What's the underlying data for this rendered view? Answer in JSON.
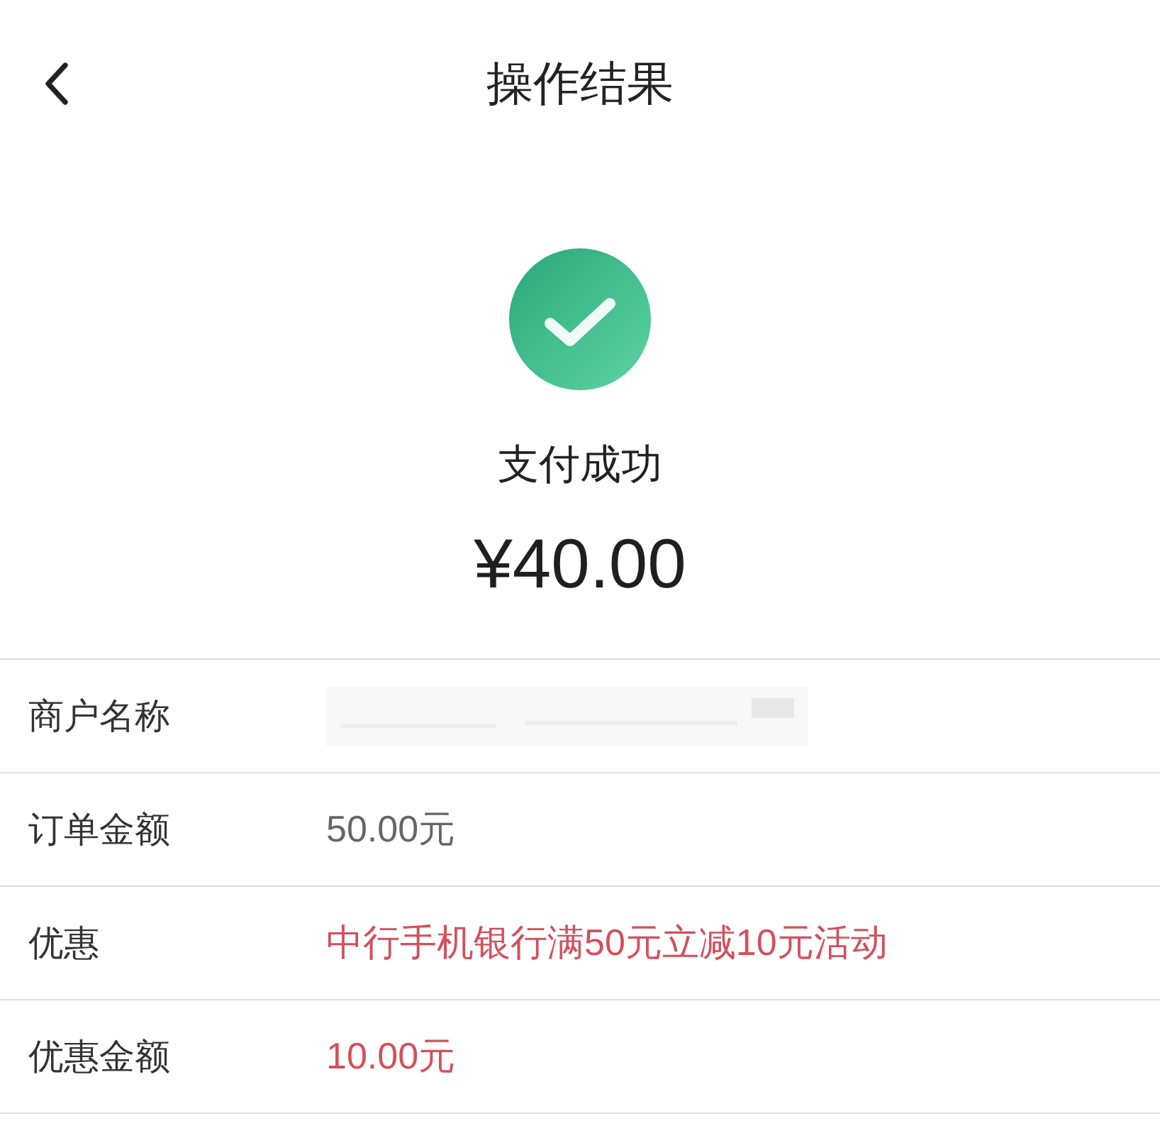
{
  "header": {
    "title": "操作结果"
  },
  "result": {
    "kind": "success",
    "message": "支付成功",
    "amount": "¥40.00"
  },
  "details": [
    {
      "label": "商户名称",
      "kind": "redacted"
    },
    {
      "label": "订单金额",
      "value": "50.00元",
      "kind": "plain"
    },
    {
      "label": "优惠",
      "value": "中行手机银行满50元立减10元活动",
      "kind": "promo"
    },
    {
      "label": "优惠金额",
      "value": "10.00元",
      "kind": "promo"
    }
  ]
}
